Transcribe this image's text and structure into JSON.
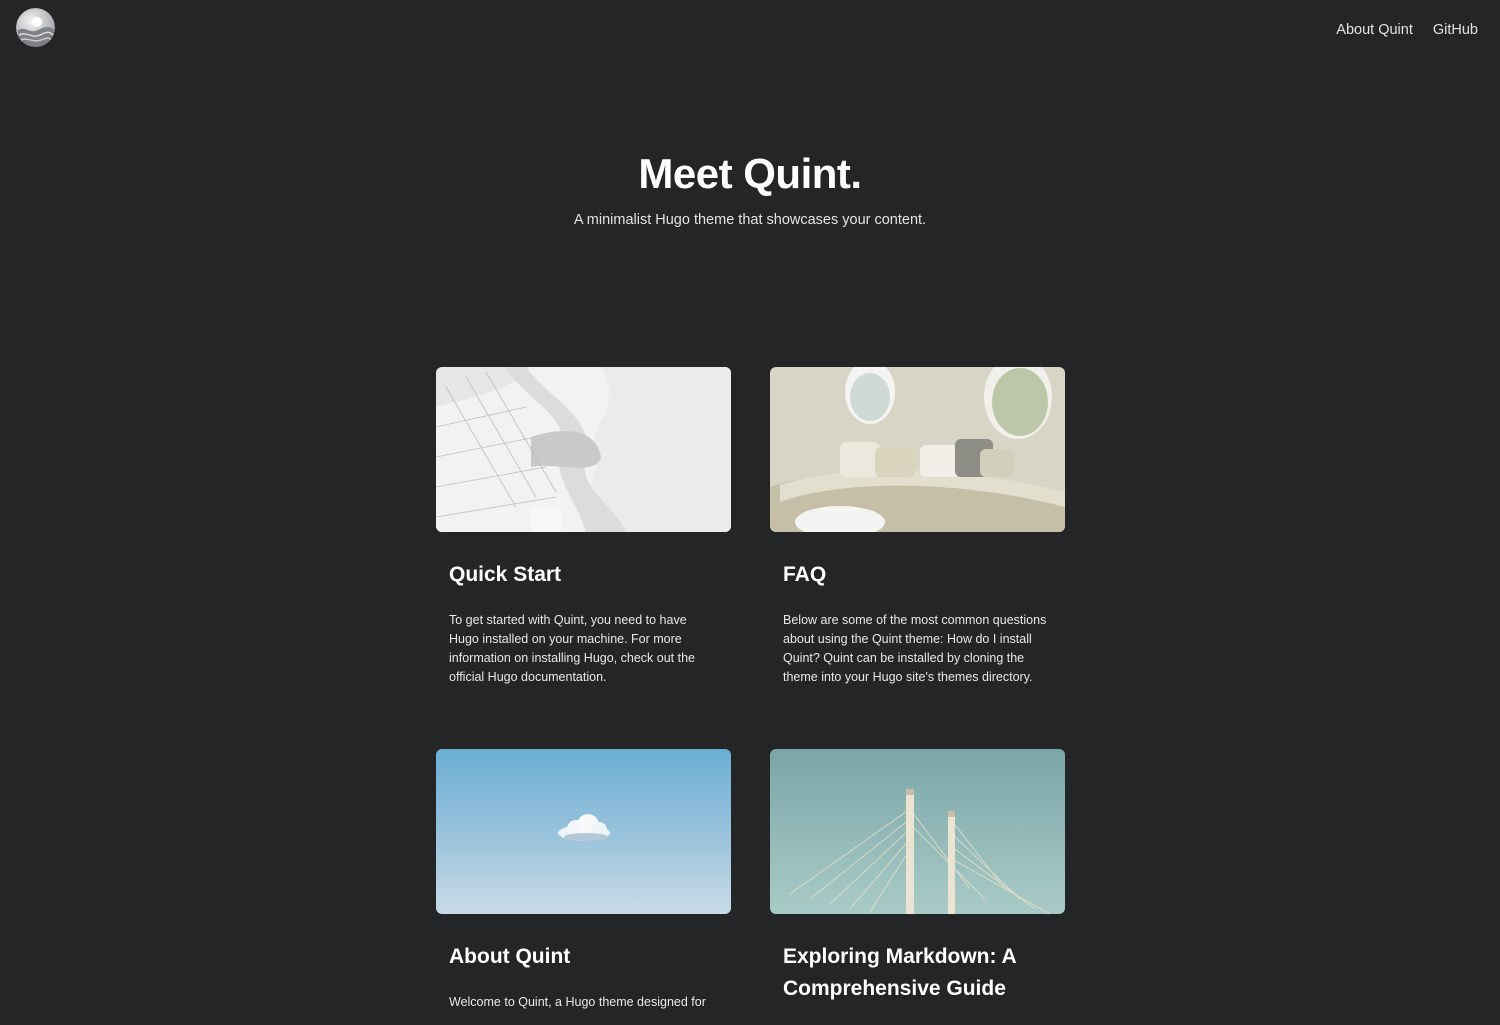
{
  "header": {
    "logo_icon": "quint-logo-icon",
    "nav": [
      {
        "label": "About Quint"
      },
      {
        "label": "GitHub"
      }
    ]
  },
  "hero": {
    "title": "Meet Quint.",
    "subtitle": "A minimalist Hugo theme that showcases your content."
  },
  "posts": [
    {
      "title": "Quick Start",
      "excerpt": "To get started with Quint, you need to have Hugo installed on your machine. For more information on installing Hugo, check out the official Hugo documentation.",
      "image": "white-architecture-image"
    },
    {
      "title": "FAQ",
      "excerpt": "Below are some of the most common questions about using the Quint theme: How do I install Quint? Quint can be installed by cloning the theme into your Hugo site's themes directory.",
      "image": "lounge-interior-image"
    },
    {
      "title": "About Quint",
      "excerpt": "Welcome to Quint, a Hugo theme designed for",
      "image": "sky-cloud-image"
    },
    {
      "title": "Exploring Markdown: A Comprehensive Guide",
      "excerpt": "",
      "image": "bridge-pylons-image"
    }
  ],
  "colors": {
    "background": "#242527",
    "text": "#ffffff",
    "nav_text": "#e2e2e2"
  }
}
